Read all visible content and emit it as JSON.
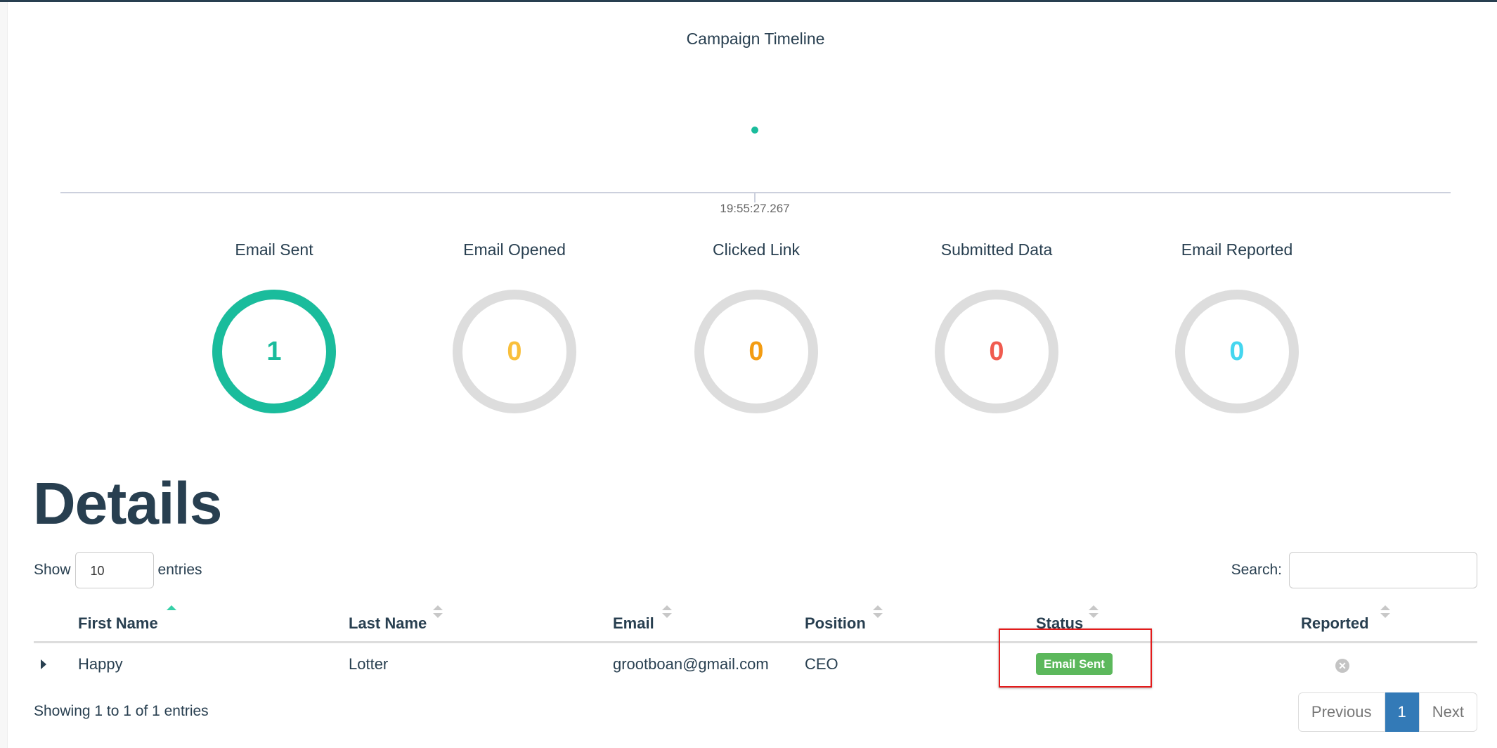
{
  "timeline": {
    "title": "Campaign Timeline",
    "tick_label": "19:55:27.267",
    "point_color": "#1abc9c"
  },
  "stats": [
    {
      "label": "Email Sent",
      "value": "1",
      "color": "#1abc9c",
      "fraction": 1
    },
    {
      "label": "Email Opened",
      "value": "0",
      "color": "#f9bf3b",
      "fraction": 0
    },
    {
      "label": "Clicked Link",
      "value": "0",
      "color": "#f39c12",
      "fraction": 0
    },
    {
      "label": "Submitted Data",
      "value": "0",
      "color": "#f05b4f",
      "fraction": 0
    },
    {
      "label": "Email Reported",
      "value": "0",
      "color": "#45d6ef",
      "fraction": 0
    }
  ],
  "details": {
    "heading": "Details",
    "show_label": "Show",
    "entries_label": "entries",
    "page_length": "10",
    "search_label": "Search:",
    "search_value": "",
    "columns": [
      "First Name",
      "Last Name",
      "Email",
      "Position",
      "Status",
      "Reported"
    ],
    "rows": [
      {
        "first_name": "Happy",
        "last_name": "Lotter",
        "email": "grootboan@gmail.com",
        "position": "CEO",
        "status": "Email Sent",
        "reported_icon": "times-circle-icon"
      }
    ],
    "info": "Showing 1 to 1 of 1 entries",
    "pagination": {
      "previous": "Previous",
      "current": "1",
      "next": "Next"
    }
  },
  "colors": {
    "heading": "#283f50",
    "status_badge": "#5cb85c",
    "page_active": "#337ab7",
    "highlight": "#e31b1b",
    "donut_track": "#dddddd"
  }
}
